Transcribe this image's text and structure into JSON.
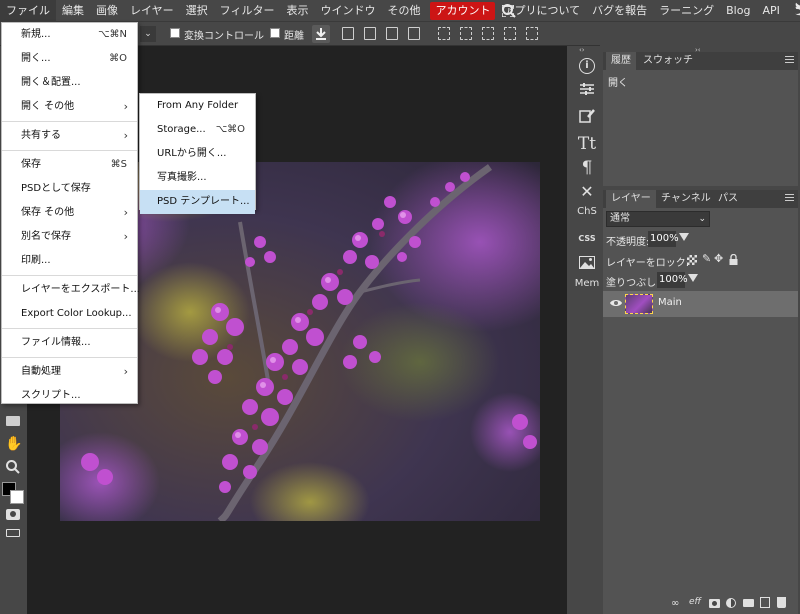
{
  "menubar": {
    "items": [
      "ファイル",
      "編集",
      "画像",
      "レイヤー",
      "選択",
      "フィルター",
      "表示",
      "ウインドウ",
      "その他"
    ],
    "account": "アカウント",
    "links": [
      "アプリについて",
      "バグを報告",
      "ラーニング",
      "Blog",
      "API"
    ]
  },
  "options": {
    "transform_controls": "変換コントロール",
    "distance": "距離"
  },
  "file_menu": {
    "items": [
      {
        "label": "新規...",
        "shortcut": "⌥⌘N"
      },
      {
        "label": "開く...",
        "shortcut": "⌘O"
      },
      {
        "label": "開く＆配置..."
      },
      {
        "label": "開く その他",
        "submenu": true
      },
      {
        "label": "共有する",
        "submenu": true
      },
      {
        "label": "保存",
        "shortcut": "⌘S"
      },
      {
        "label": "PSDとして保存"
      },
      {
        "label": "保存 その他",
        "submenu": true
      },
      {
        "label": "別名で保存",
        "submenu": true
      },
      {
        "label": "印刷..."
      },
      {
        "label": "レイヤーをエクスポート..."
      },
      {
        "label": "Export Color Lookup..."
      },
      {
        "label": "ファイル情報..."
      },
      {
        "label": "自動処理",
        "submenu": true
      },
      {
        "label": "スクリプト..."
      }
    ]
  },
  "open_submenu": {
    "items": [
      {
        "label": "From Any Folder"
      },
      {
        "label": "Storage...",
        "shortcut": "⌥⌘O"
      },
      {
        "label": "URLから開く..."
      },
      {
        "label": "写真撮影..."
      },
      {
        "label": "PSD テンプレート...",
        "highlighted": true
      }
    ]
  },
  "history_panel": {
    "tabs": [
      "履歴",
      "スウォッチ"
    ],
    "entries": [
      "開く"
    ]
  },
  "layers_panel": {
    "tabs": [
      "レイヤー",
      "チャンネル",
      "パス"
    ],
    "blend_mode": "通常",
    "opacity_label": "不透明度:",
    "opacity_value": "100%",
    "lock_label": "レイヤーをロック:",
    "fill_label": "塗りつぶし:",
    "fill_value": "100%",
    "layers": [
      {
        "name": "Main",
        "visible": true
      }
    ],
    "footer_icons": [
      "link-icon",
      "effects-icon",
      "mask-icon",
      "adjustment-icon",
      "folder-icon",
      "new-layer-icon",
      "delete-icon"
    ]
  },
  "icon_column": {
    "labels": [
      "ChS",
      "CSS",
      "Mem"
    ]
  },
  "colors": {
    "ui_bg": "#474747",
    "canvas_bg": "#222222",
    "account_red": "#cc1515",
    "menu_highlight": "#c7e0f4"
  }
}
